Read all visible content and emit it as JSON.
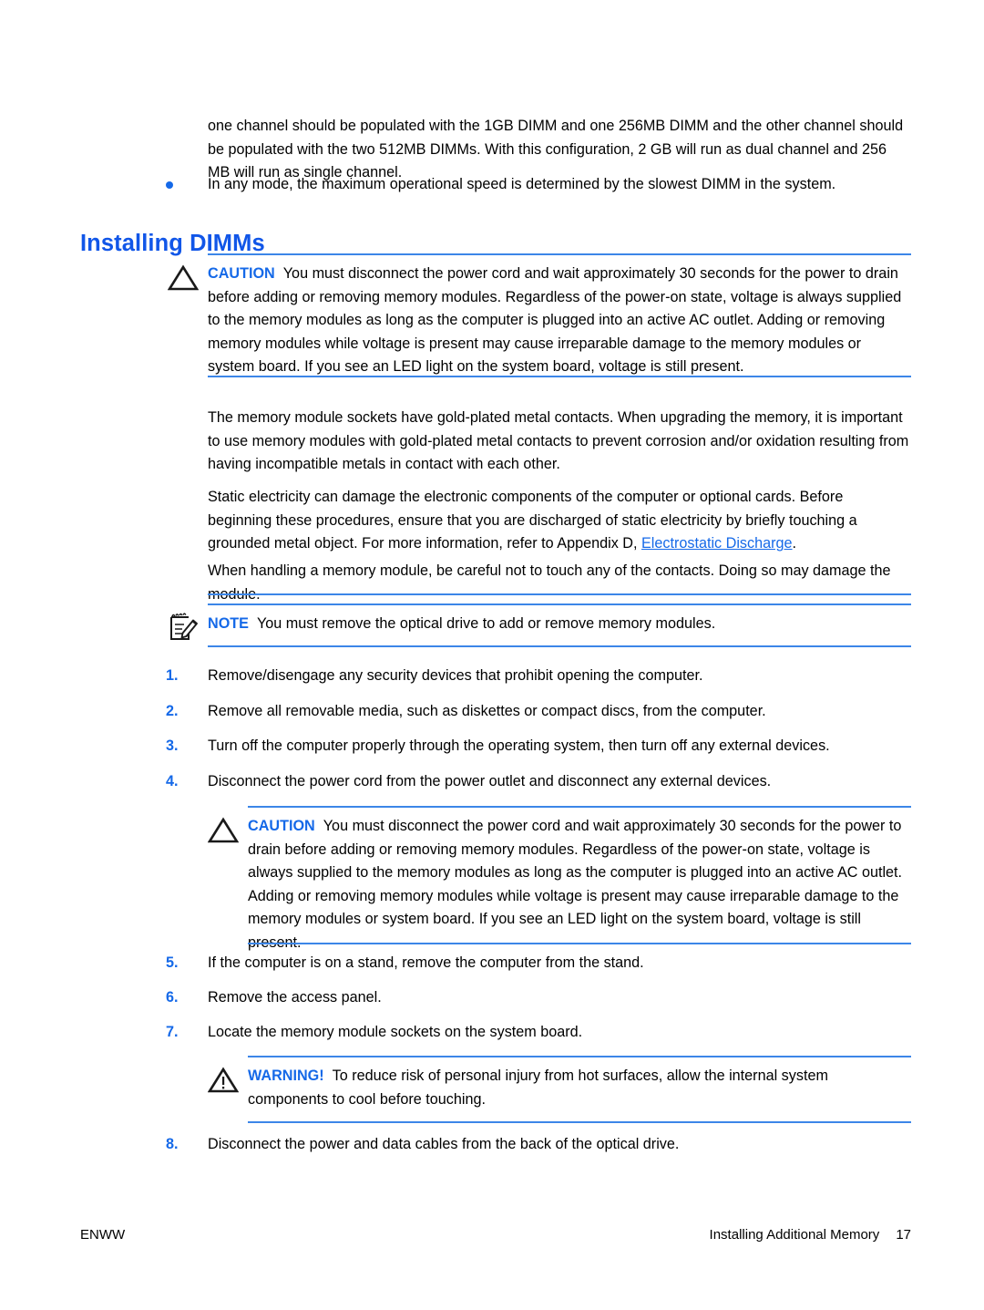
{
  "page": {
    "intro_paragraph": "one channel should be populated with the 1GB DIMM and one 256MB DIMM and the other channel should be populated with the two 512MB DIMMs. With this configuration, 2 GB will run as dual channel and 256 MB will run as single channel.",
    "bullet": {
      "icon": "bullet-dot-icon",
      "text": "In any mode, the maximum operational speed is determined by the slowest DIMM in the system."
    },
    "heading": "Installing DIMMs"
  },
  "caution_1": {
    "icon": "caution-triangle-icon",
    "label": "CAUTION",
    "text": "You must disconnect the power cord and wait approximately 30 seconds for the power to drain before adding or removing memory modules. Regardless of the power-on state, voltage is always supplied to the memory modules as long as the computer is plugged into an active AC outlet. Adding or removing memory modules while voltage is present may cause irreparable damage to the memory modules or system board. If you see an LED light on the system board, voltage is still present."
  },
  "paragraphs": {
    "gold_contacts": "The memory module sockets have gold-plated metal contacts. When upgrading the memory, it is important to use memory modules with gold-plated metal contacts to prevent corrosion and/or oxidation resulting from having incompatible metals in contact with each other.",
    "static_part_1": "Static electricity can damage the electronic components of the computer or optional cards. Before beginning these procedures, ensure that you are discharged of static electricity by briefly touching a grounded metal object. For more information, refer to Appendix D, ",
    "static_link": "Electrostatic Discharge",
    "static_part_2": ".",
    "handling": "When handling a memory module, be careful not to touch any of the contacts. Doing so may damage the module."
  },
  "note_1": {
    "icon": "note-pad-pencil-icon",
    "label": "NOTE",
    "text": "You must remove the optical drive to add or remove memory modules."
  },
  "steps_first": [
    {
      "number": "1.",
      "text": "Remove/disengage any security devices that prohibit opening the computer."
    },
    {
      "number": "2.",
      "text": "Remove all removable media, such as diskettes or compact discs, from the computer."
    },
    {
      "number": "3.",
      "text": "Turn off the computer properly through the operating system, then turn off any external devices."
    },
    {
      "number": "4.",
      "text": "Disconnect the power cord from the power outlet and disconnect any external devices."
    }
  ],
  "caution_2": {
    "icon": "caution-triangle-icon",
    "label": "CAUTION",
    "text": "You must disconnect the power cord and wait approximately 30 seconds for the power to drain before adding or removing memory modules. Regardless of the power-on state, voltage is always supplied to the memory modules as long as the computer is plugged into an active AC outlet. Adding or removing memory modules while voltage is present may cause irreparable damage to the memory modules or system board. If you see an LED light on the system board, voltage is still present."
  },
  "steps_second": [
    {
      "number": "5.",
      "text": "If the computer is on a stand, remove the computer from the stand."
    },
    {
      "number": "6.",
      "text": "Remove the access panel."
    },
    {
      "number": "7.",
      "text": "Locate the memory module sockets on the system board."
    }
  ],
  "warning_1": {
    "icon": "warning-triangle-icon",
    "label": "WARNING!",
    "text": "To reduce risk of personal injury from hot surfaces, allow the internal system components to cool before touching."
  },
  "steps_third": [
    {
      "number": "8.",
      "text": "Disconnect the power and data cables from the back of the optical drive."
    }
  ],
  "footer": {
    "left": "ENWW",
    "section": "Installing Additional Memory",
    "page_number": "17"
  },
  "colors": {
    "accent_blue": "#1569e8",
    "heading_blue": "#1156e8",
    "rule_blue": "#3c86e8",
    "text_black": "#000000"
  }
}
